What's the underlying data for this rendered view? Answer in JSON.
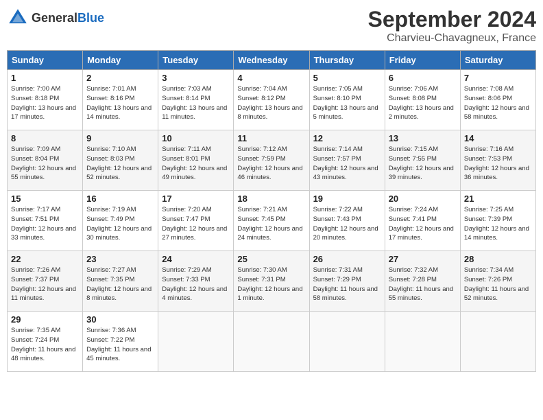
{
  "header": {
    "logo_general": "General",
    "logo_blue": "Blue",
    "month": "September 2024",
    "location": "Charvieu-Chavagneux, France"
  },
  "columns": [
    "Sunday",
    "Monday",
    "Tuesday",
    "Wednesday",
    "Thursday",
    "Friday",
    "Saturday"
  ],
  "weeks": [
    [
      {
        "day": "1",
        "sunrise": "Sunrise: 7:00 AM",
        "sunset": "Sunset: 8:18 PM",
        "daylight": "Daylight: 13 hours and 17 minutes."
      },
      {
        "day": "2",
        "sunrise": "Sunrise: 7:01 AM",
        "sunset": "Sunset: 8:16 PM",
        "daylight": "Daylight: 13 hours and 14 minutes."
      },
      {
        "day": "3",
        "sunrise": "Sunrise: 7:03 AM",
        "sunset": "Sunset: 8:14 PM",
        "daylight": "Daylight: 13 hours and 11 minutes."
      },
      {
        "day": "4",
        "sunrise": "Sunrise: 7:04 AM",
        "sunset": "Sunset: 8:12 PM",
        "daylight": "Daylight: 13 hours and 8 minutes."
      },
      {
        "day": "5",
        "sunrise": "Sunrise: 7:05 AM",
        "sunset": "Sunset: 8:10 PM",
        "daylight": "Daylight: 13 hours and 5 minutes."
      },
      {
        "day": "6",
        "sunrise": "Sunrise: 7:06 AM",
        "sunset": "Sunset: 8:08 PM",
        "daylight": "Daylight: 13 hours and 2 minutes."
      },
      {
        "day": "7",
        "sunrise": "Sunrise: 7:08 AM",
        "sunset": "Sunset: 8:06 PM",
        "daylight": "Daylight: 12 hours and 58 minutes."
      }
    ],
    [
      {
        "day": "8",
        "sunrise": "Sunrise: 7:09 AM",
        "sunset": "Sunset: 8:04 PM",
        "daylight": "Daylight: 12 hours and 55 minutes."
      },
      {
        "day": "9",
        "sunrise": "Sunrise: 7:10 AM",
        "sunset": "Sunset: 8:03 PM",
        "daylight": "Daylight: 12 hours and 52 minutes."
      },
      {
        "day": "10",
        "sunrise": "Sunrise: 7:11 AM",
        "sunset": "Sunset: 8:01 PM",
        "daylight": "Daylight: 12 hours and 49 minutes."
      },
      {
        "day": "11",
        "sunrise": "Sunrise: 7:12 AM",
        "sunset": "Sunset: 7:59 PM",
        "daylight": "Daylight: 12 hours and 46 minutes."
      },
      {
        "day": "12",
        "sunrise": "Sunrise: 7:14 AM",
        "sunset": "Sunset: 7:57 PM",
        "daylight": "Daylight: 12 hours and 43 minutes."
      },
      {
        "day": "13",
        "sunrise": "Sunrise: 7:15 AM",
        "sunset": "Sunset: 7:55 PM",
        "daylight": "Daylight: 12 hours and 39 minutes."
      },
      {
        "day": "14",
        "sunrise": "Sunrise: 7:16 AM",
        "sunset": "Sunset: 7:53 PM",
        "daylight": "Daylight: 12 hours and 36 minutes."
      }
    ],
    [
      {
        "day": "15",
        "sunrise": "Sunrise: 7:17 AM",
        "sunset": "Sunset: 7:51 PM",
        "daylight": "Daylight: 12 hours and 33 minutes."
      },
      {
        "day": "16",
        "sunrise": "Sunrise: 7:19 AM",
        "sunset": "Sunset: 7:49 PM",
        "daylight": "Daylight: 12 hours and 30 minutes."
      },
      {
        "day": "17",
        "sunrise": "Sunrise: 7:20 AM",
        "sunset": "Sunset: 7:47 PM",
        "daylight": "Daylight: 12 hours and 27 minutes."
      },
      {
        "day": "18",
        "sunrise": "Sunrise: 7:21 AM",
        "sunset": "Sunset: 7:45 PM",
        "daylight": "Daylight: 12 hours and 24 minutes."
      },
      {
        "day": "19",
        "sunrise": "Sunrise: 7:22 AM",
        "sunset": "Sunset: 7:43 PM",
        "daylight": "Daylight: 12 hours and 20 minutes."
      },
      {
        "day": "20",
        "sunrise": "Sunrise: 7:24 AM",
        "sunset": "Sunset: 7:41 PM",
        "daylight": "Daylight: 12 hours and 17 minutes."
      },
      {
        "day": "21",
        "sunrise": "Sunrise: 7:25 AM",
        "sunset": "Sunset: 7:39 PM",
        "daylight": "Daylight: 12 hours and 14 minutes."
      }
    ],
    [
      {
        "day": "22",
        "sunrise": "Sunrise: 7:26 AM",
        "sunset": "Sunset: 7:37 PM",
        "daylight": "Daylight: 12 hours and 11 minutes."
      },
      {
        "day": "23",
        "sunrise": "Sunrise: 7:27 AM",
        "sunset": "Sunset: 7:35 PM",
        "daylight": "Daylight: 12 hours and 8 minutes."
      },
      {
        "day": "24",
        "sunrise": "Sunrise: 7:29 AM",
        "sunset": "Sunset: 7:33 PM",
        "daylight": "Daylight: 12 hours and 4 minutes."
      },
      {
        "day": "25",
        "sunrise": "Sunrise: 7:30 AM",
        "sunset": "Sunset: 7:31 PM",
        "daylight": "Daylight: 12 hours and 1 minute."
      },
      {
        "day": "26",
        "sunrise": "Sunrise: 7:31 AM",
        "sunset": "Sunset: 7:29 PM",
        "daylight": "Daylight: 11 hours and 58 minutes."
      },
      {
        "day": "27",
        "sunrise": "Sunrise: 7:32 AM",
        "sunset": "Sunset: 7:28 PM",
        "daylight": "Daylight: 11 hours and 55 minutes."
      },
      {
        "day": "28",
        "sunrise": "Sunrise: 7:34 AM",
        "sunset": "Sunset: 7:26 PM",
        "daylight": "Daylight: 11 hours and 52 minutes."
      }
    ],
    [
      {
        "day": "29",
        "sunrise": "Sunrise: 7:35 AM",
        "sunset": "Sunset: 7:24 PM",
        "daylight": "Daylight: 11 hours and 48 minutes."
      },
      {
        "day": "30",
        "sunrise": "Sunrise: 7:36 AM",
        "sunset": "Sunset: 7:22 PM",
        "daylight": "Daylight: 11 hours and 45 minutes."
      },
      {
        "day": "",
        "sunrise": "",
        "sunset": "",
        "daylight": ""
      },
      {
        "day": "",
        "sunrise": "",
        "sunset": "",
        "daylight": ""
      },
      {
        "day": "",
        "sunrise": "",
        "sunset": "",
        "daylight": ""
      },
      {
        "day": "",
        "sunrise": "",
        "sunset": "",
        "daylight": ""
      },
      {
        "day": "",
        "sunrise": "",
        "sunset": "",
        "daylight": ""
      }
    ]
  ]
}
